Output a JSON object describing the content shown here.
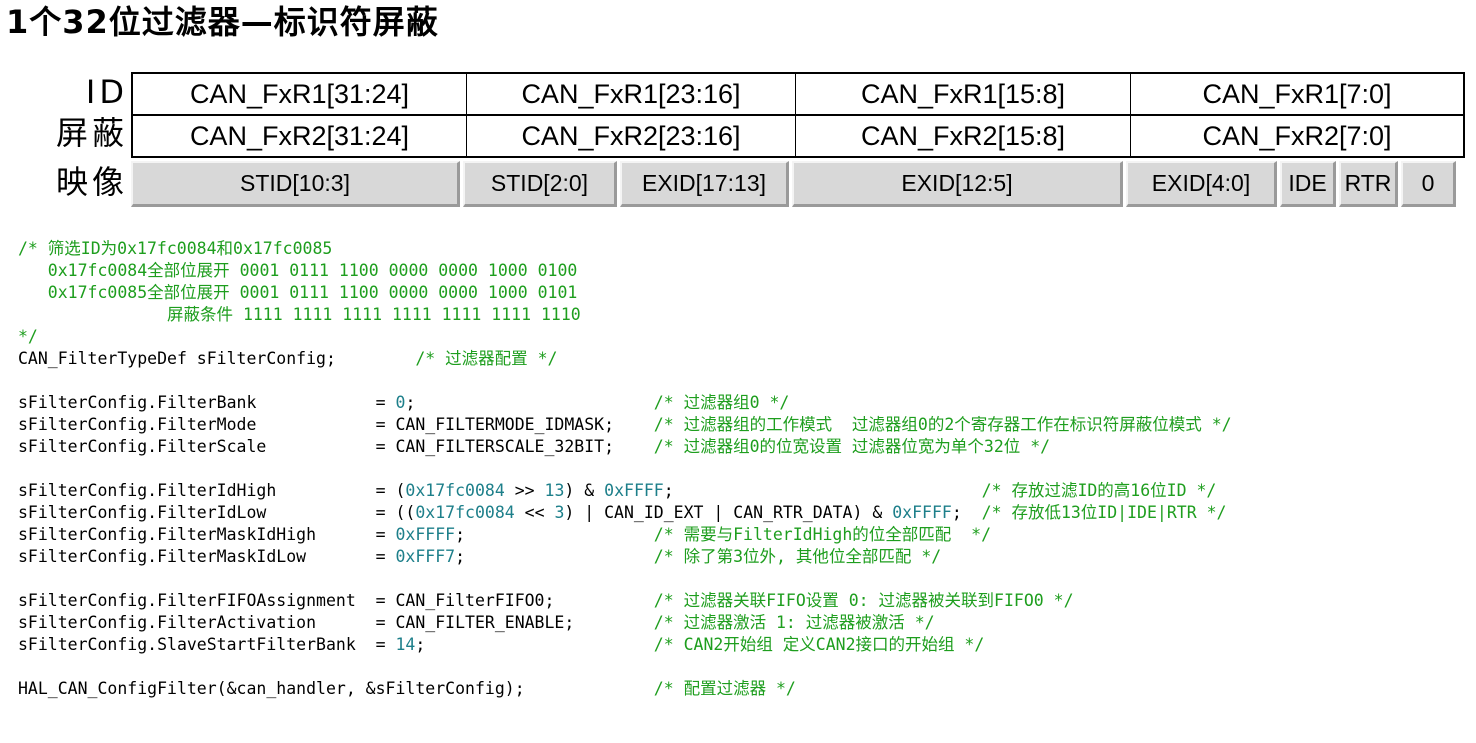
{
  "title": "1个32位过滤器—标识符屏蔽",
  "row_labels": {
    "id": "ID",
    "mask": "屏蔽",
    "map": "映像"
  },
  "id_row": [
    "CAN_FxR1[31:24]",
    "CAN_FxR1[23:16]",
    "CAN_FxR1[15:8]",
    "CAN_FxR1[7:0]"
  ],
  "mask_row": [
    "CAN_FxR2[31:24]",
    "CAN_FxR2[23:16]",
    "CAN_FxR2[15:8]",
    "CAN_FxR2[7:0]"
  ],
  "map_row": [
    "STID[10:3]",
    "STID[2:0]",
    "EXID[17:13]",
    "EXID[12:5]",
    "EXID[4:0]",
    "IDE",
    "RTR",
    "0"
  ],
  "code_lines": [
    [
      {
        "t": "/* 筛选ID为0x17fc0084和0x17fc0085",
        "c": "cm"
      }
    ],
    [
      {
        "t": "   0x17fc0084全部位展开 0001 0111 1100 0000 0000 1000 0100",
        "c": "cm"
      }
    ],
    [
      {
        "t": "   0x17fc0085全部位展开 0001 0111 1100 0000 0000 1000 0101",
        "c": "cm"
      }
    ],
    [
      {
        "t": "               屏蔽条件 1111 1111 1111 1111 1111 1111 1110",
        "c": "cm"
      }
    ],
    [
      {
        "t": "*/",
        "c": "cm"
      }
    ],
    [
      {
        "t": "CAN_FilterTypeDef sFilterConfig;        "
      },
      {
        "t": "/* 过滤器配置 */",
        "c": "cm"
      }
    ],
    [],
    [
      {
        "t": "sFilterConfig.FilterBank            = "
      },
      {
        "t": "0",
        "c": "num"
      },
      {
        "t": ";                        "
      },
      {
        "t": "/* 过滤器组0 */",
        "c": "cm"
      }
    ],
    [
      {
        "t": "sFilterConfig.FilterMode            = CAN_FILTERMODE_IDMASK;    "
      },
      {
        "t": "/* 过滤器组的工作模式  过滤器组0的2个寄存器工作在标识符屏蔽位模式 */",
        "c": "cm"
      }
    ],
    [
      {
        "t": "sFilterConfig.FilterScale           = CAN_FILTERSCALE_32BIT;    "
      },
      {
        "t": "/* 过滤器组0的位宽设置 过滤器位宽为单个32位 */",
        "c": "cm"
      }
    ],
    [],
    [
      {
        "t": "sFilterConfig.FilterIdHigh          = ("
      },
      {
        "t": "0x17fc0084",
        "c": "num"
      },
      {
        "t": " >> "
      },
      {
        "t": "13",
        "c": "num"
      },
      {
        "t": ") & "
      },
      {
        "t": "0xFFFF",
        "c": "num"
      },
      {
        "t": ";                               "
      },
      {
        "t": "/* 存放过滤ID的高16位ID */",
        "c": "cm"
      }
    ],
    [
      {
        "t": "sFilterConfig.FilterIdLow           = (("
      },
      {
        "t": "0x17fc0084",
        "c": "num"
      },
      {
        "t": " << "
      },
      {
        "t": "3",
        "c": "num"
      },
      {
        "t": ") | CAN_ID_EXT | CAN_RTR_DATA) & "
      },
      {
        "t": "0xFFFF",
        "c": "num"
      },
      {
        "t": ";  "
      },
      {
        "t": "/* 存放低13位ID|IDE|RTR */",
        "c": "cm"
      }
    ],
    [
      {
        "t": "sFilterConfig.FilterMaskIdHigh      = "
      },
      {
        "t": "0xFFFF",
        "c": "num"
      },
      {
        "t": ";                   "
      },
      {
        "t": "/* 需要与FilterIdHigh的位全部匹配  */",
        "c": "cm"
      }
    ],
    [
      {
        "t": "sFilterConfig.FilterMaskIdLow       = "
      },
      {
        "t": "0xFFF7",
        "c": "num"
      },
      {
        "t": ";                   "
      },
      {
        "t": "/* 除了第3位外, 其他位全部匹配 */",
        "c": "cm"
      }
    ],
    [],
    [
      {
        "t": "sFilterConfig.FilterFIFOAssignment  = CAN_FilterFIFO0;          "
      },
      {
        "t": "/* 过滤器关联FIFO设置 0: 过滤器被关联到FIFO0 */",
        "c": "cm"
      }
    ],
    [
      {
        "t": "sFilterConfig.FilterActivation      = CAN_FILTER_ENABLE;        "
      },
      {
        "t": "/* 过滤器激活 1: 过滤器被激活 */",
        "c": "cm"
      }
    ],
    [
      {
        "t": "sFilterConfig.SlaveStartFilterBank  = "
      },
      {
        "t": "14",
        "c": "num"
      },
      {
        "t": ";                       "
      },
      {
        "t": "/* CAN2开始组 定义CAN2接口的开始组 */",
        "c": "cm"
      }
    ],
    [],
    [
      {
        "t": "HAL_CAN_ConfigFilter(&can_handler, &sFilterConfig);             "
      },
      {
        "t": "/* 配置过滤器 */",
        "c": "cm"
      }
    ]
  ]
}
